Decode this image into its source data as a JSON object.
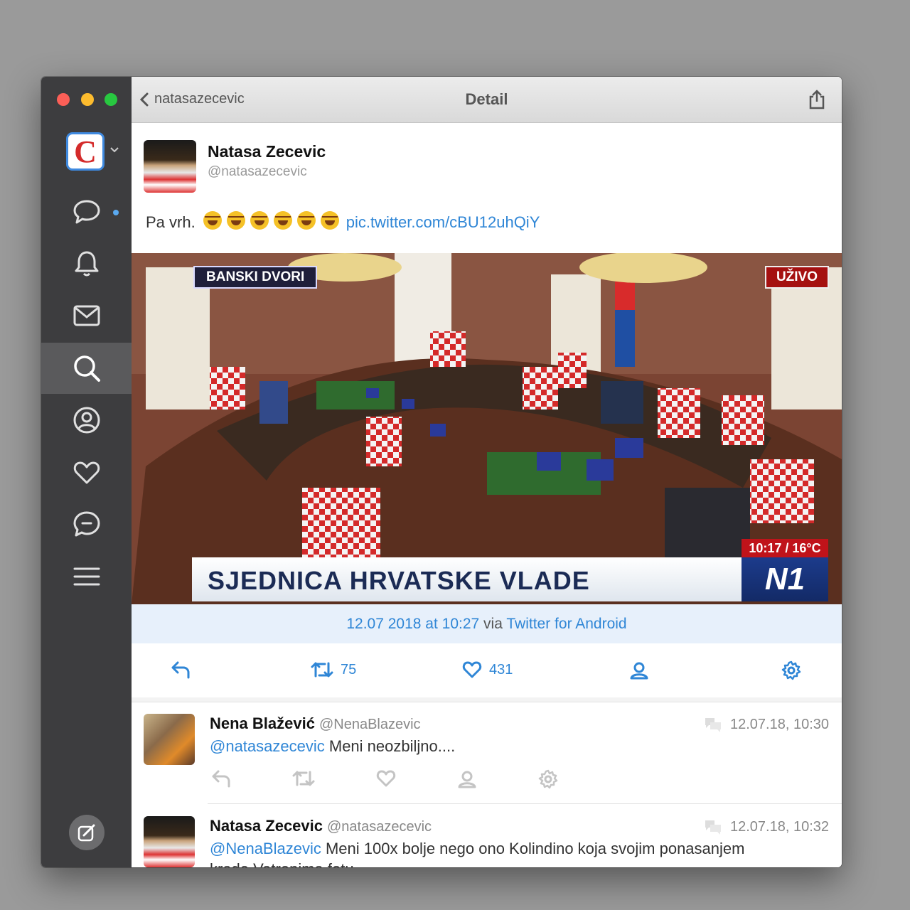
{
  "window": {
    "back_label": "natasazecevic",
    "title": "Detail"
  },
  "sidebar": {
    "account_initial": "C",
    "items": [
      {
        "icon": "chat-bubble-icon",
        "has_dot": true
      },
      {
        "icon": "bell-icon"
      },
      {
        "icon": "mail-icon"
      },
      {
        "icon": "search-icon",
        "active": true
      },
      {
        "icon": "profile-icon"
      },
      {
        "icon": "heart-icon"
      },
      {
        "icon": "message-icon"
      },
      {
        "icon": "menu-icon"
      }
    ],
    "compose_icon": "compose-icon"
  },
  "tweet": {
    "name": "Natasa Zecevic",
    "handle": "@natasazecevic",
    "text": "Pa vrh.",
    "emoji_count": 6,
    "link": "pic.twitter.com/cBU12uhQiY",
    "media": {
      "top_left_caption": "BANSKI DVORI",
      "live_badge": "UŽIVO",
      "time_temp": "10:17 / 16°C",
      "headline": "SJEDNICA HRVATSKE VLADE",
      "channel_logo": "N1"
    },
    "date": "12.07 2018 at 10:27",
    "via": "via",
    "client": "Twitter for Android",
    "retweets": "75",
    "likes": "431"
  },
  "replies": [
    {
      "name": "Nena Blažević",
      "handle": "@NenaBlazevic",
      "time": "12.07.18, 10:30",
      "mention": "@natasazecevic",
      "text": " Meni neozbiljno...."
    },
    {
      "name": "Natasa Zecevic",
      "handle": "@natasazecevic",
      "time": "12.07.18, 10:32",
      "mention": "@NenaBlazevic",
      "text": " Meni 100x bolje nego ono Kolindino koja svojim ponasanjem",
      "text_line2": "krade Vatrenima fotu"
    }
  ],
  "colors": {
    "accent": "#2f86d6",
    "sidebar": "#3d3d3f",
    "meta_bar": "#e7f0fb"
  }
}
